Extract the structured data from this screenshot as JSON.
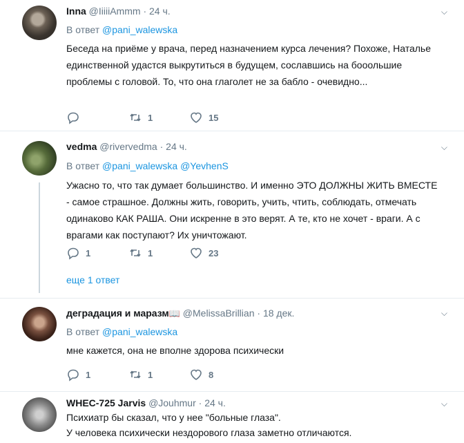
{
  "tweets": [
    {
      "name": "Inna",
      "handle": "@IiiiiAmmm",
      "time": "24 ч.",
      "reply_label": "В ответ",
      "mentions": "@pani_walewska",
      "text": "Беседа на приёме у врача, перед назначением курса лечения? Похоже, Наталье единственной удастся выкрутиться в будущем, сославшись на бооольшие проблемы с головой. То, что она глаголет не за бабло - очевидно...",
      "replies": "",
      "retweets": "1",
      "likes": "15"
    },
    {
      "name": "vedma",
      "handle": "@rivervedma",
      "time": "24 ч.",
      "reply_label": "В ответ",
      "mentions": "@pani_walewska @YevhenS",
      "text": "Ужасно то, что так думает большинство. И именно ЭТО ДОЛЖНЫ ЖИТЬ ВМЕСТЕ - самое страшное. Должны жить, говорить, учить, чтить, соблюдать, отмечать одинаково КАК РАША. Они искренне в это верят. А те, кто не хочет - враги. А с врагами как поступают? Их уничтожают.",
      "replies": "1",
      "retweets": "1",
      "likes": "23",
      "more_replies": "еще 1 ответ"
    },
    {
      "name": "деградация и маразм",
      "handle": "@MelissaBrillian",
      "time": "18 дек.",
      "reply_label": "В ответ",
      "mentions": "@pani_walewska",
      "text": "мне кажется, она не вполне здорова психически",
      "replies": "1",
      "retweets": "1",
      "likes": "8"
    },
    {
      "name": "WHEC-725 Jarvis",
      "handle": "@Jouhmur",
      "time": "24 ч.",
      "text_line1": "Психиатр бы сказал, что у нее \"больные глаза\".",
      "text_line2": "У человека психически нездорового глаза заметно отличаются."
    }
  ],
  "separator": "·",
  "icons": {
    "reply": "reply-icon",
    "retweet": "retweet-icon",
    "like": "heart-icon",
    "caret": "chevron-down-icon",
    "book": "book-icon"
  },
  "colors": {
    "link": "#1b95e0",
    "muted": "#657786",
    "text": "#14171a",
    "divider": "#e6ecf0"
  }
}
